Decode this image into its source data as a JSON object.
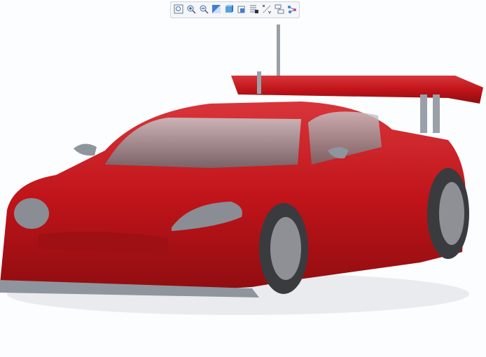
{
  "toolbar": {
    "buttons": [
      {
        "name": "zoom-to-fit",
        "icon": "zoom-fit-icon"
      },
      {
        "name": "zoom-in",
        "icon": "zoom-in-icon"
      },
      {
        "name": "zoom-out",
        "icon": "zoom-out-icon"
      },
      {
        "name": "view-orientation",
        "icon": "orientation-icon"
      },
      {
        "name": "display-style",
        "icon": "shaded-cube-icon"
      },
      {
        "name": "section-view",
        "icon": "section-icon"
      },
      {
        "name": "model-tree",
        "icon": "tree-icon"
      },
      {
        "name": "datum-display",
        "icon": "datum-icon"
      },
      {
        "name": "explode-view",
        "icon": "explode-icon"
      },
      {
        "name": "connections",
        "icon": "network-icon"
      }
    ]
  },
  "colors": {
    "body": "#c8141a",
    "accent": "#3f7fd0"
  }
}
